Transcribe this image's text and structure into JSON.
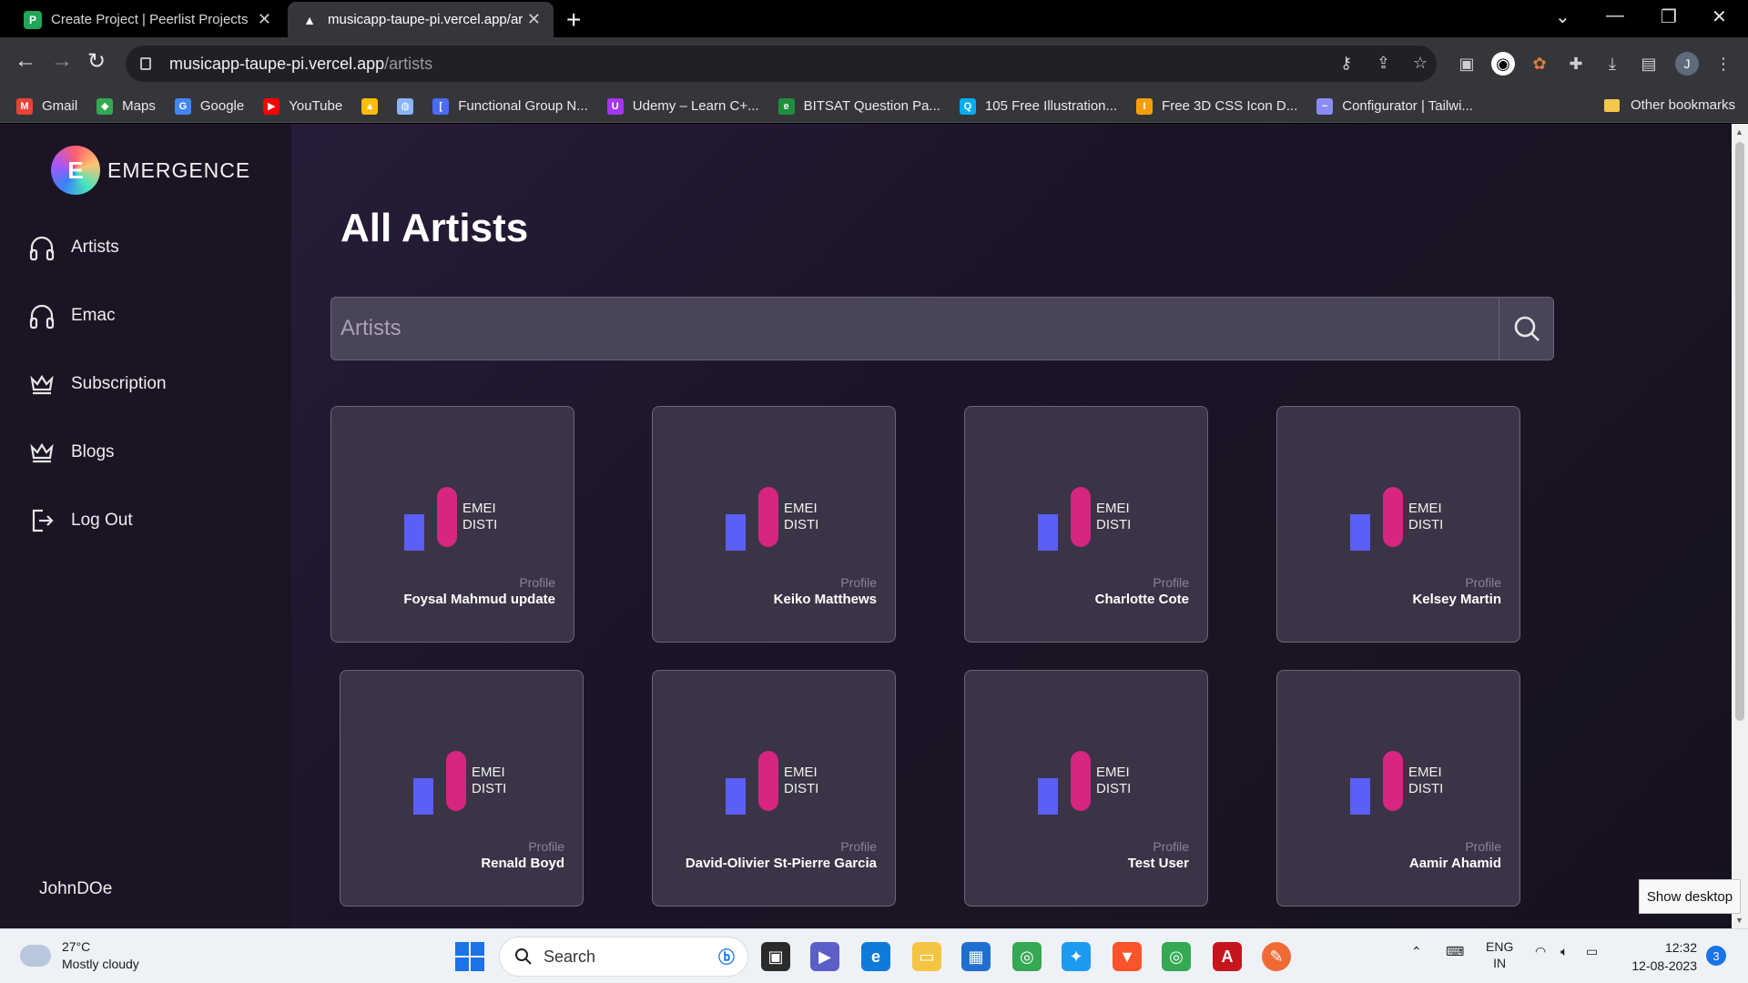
{
  "browser": {
    "tabs": [
      {
        "title": "Create Project | Peerlist Projects",
        "favicon_letter": "P"
      },
      {
        "title": "musicapp-taupe-pi.vercel.app/ar",
        "favicon_letter": "▲"
      }
    ],
    "new_tab": "+",
    "url_host": "musicapp-taupe-pi.vercel.app",
    "url_path": "/artists",
    "profile_initial": "J",
    "bookmarks": [
      {
        "label": "Gmail",
        "color": "#ea4335",
        "glyph": "M"
      },
      {
        "label": "Maps",
        "color": "#34a853",
        "glyph": "◆"
      },
      {
        "label": "Google",
        "color": "#4285f4",
        "glyph": "G"
      },
      {
        "label": "YouTube",
        "color": "#ff0000",
        "glyph": "▶"
      },
      {
        "label": "",
        "color": "#fbbc04",
        "glyph": "▲"
      },
      {
        "label": "",
        "color": "#8ab4f8",
        "glyph": "◍"
      },
      {
        "label": "Functional Group N...",
        "color": "#4a6cf7",
        "glyph": "["
      },
      {
        "label": "Udemy – Learn C+...",
        "color": "#a435f0",
        "glyph": "U"
      },
      {
        "label": "BITSAT Question Pa...",
        "color": "#1e8e3e",
        "glyph": "e"
      },
      {
        "label": "105 Free Illustration...",
        "color": "#00aeef",
        "glyph": "Q"
      },
      {
        "label": "Free 3D CSS Icon D...",
        "color": "#f59e0b",
        "glyph": "I"
      },
      {
        "label": "Configurator | Tailwi...",
        "color": "#8b8bf5",
        "glyph": "~"
      }
    ],
    "other_bookmarks": "Other bookmarks"
  },
  "app": {
    "brand": "EMERGENCE",
    "logo_letter": "E",
    "nav": [
      {
        "label": "Artists",
        "icon": "headphones-icon"
      },
      {
        "label": "Emac",
        "icon": "headphones-icon"
      },
      {
        "label": "Subscription",
        "icon": "crown-icon"
      },
      {
        "label": "Blogs",
        "icon": "crown-icon"
      },
      {
        "label": "Log Out",
        "icon": "logout-icon"
      }
    ],
    "user": "JohnDOe",
    "page_title": "All Artists",
    "search_placeholder": "Artists",
    "card_art_text_1": "EMEI",
    "card_art_text_2": "DISTI",
    "artists": [
      {
        "label": "Profile",
        "name": "Foysal Mahmud update"
      },
      {
        "label": "Profile",
        "name": "Keiko Matthews"
      },
      {
        "label": "Profile",
        "name": "Charlotte Cote"
      },
      {
        "label": "Profile",
        "name": "Kelsey Martin"
      },
      {
        "label": "Profile",
        "name": "Renald Boyd"
      },
      {
        "label": "Profile",
        "name": "David-Olivier St-Pierre Garcia"
      },
      {
        "label": "Profile",
        "name": "Test User"
      },
      {
        "label": "Profile",
        "name": "Aamir Ahamid"
      }
    ],
    "colors": {
      "bar_blue": "#5b5ff5",
      "bar_pink": "#d6267f"
    }
  },
  "tooltip": "Show desktop",
  "taskbar": {
    "temperature": "27°C",
    "weather": "Mostly cloudy",
    "search": "Search",
    "lang1": "ENG",
    "lang2": "IN",
    "time": "12:32",
    "date": "12-08-2023",
    "notifications": "3"
  }
}
